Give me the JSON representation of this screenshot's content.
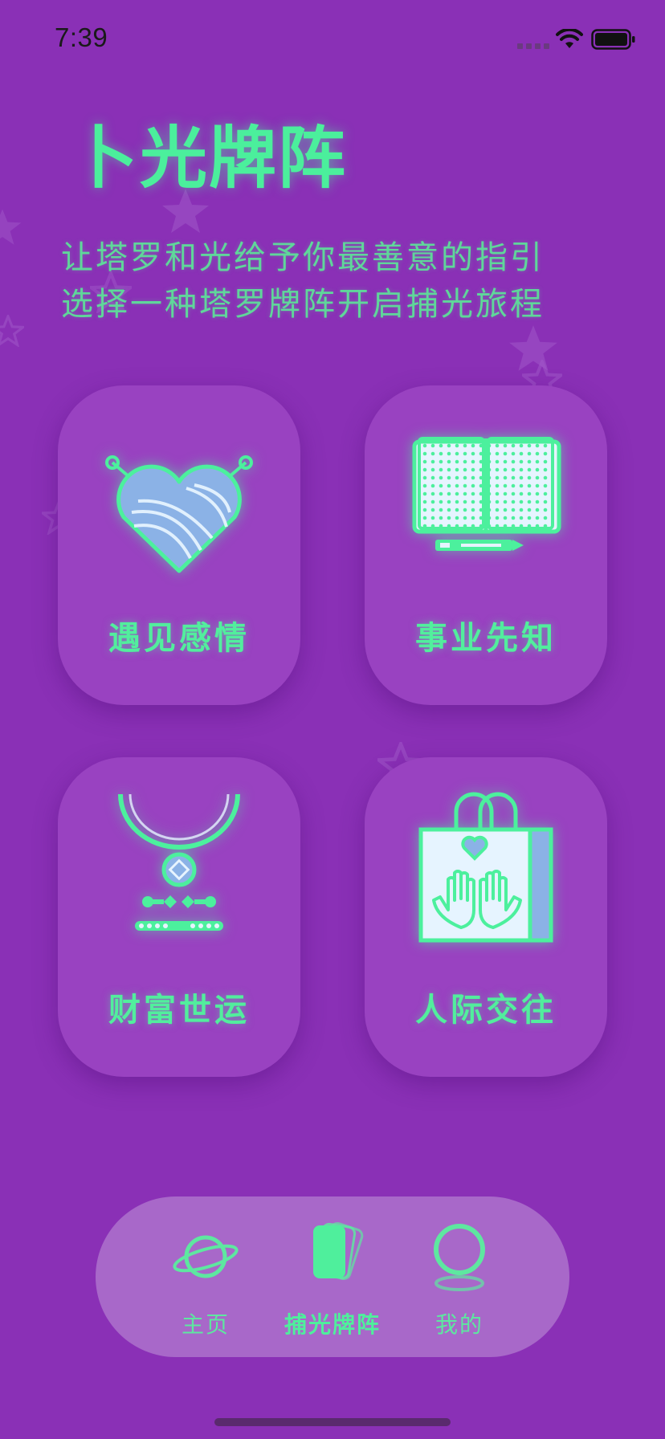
{
  "status_bar": {
    "time": "7:39"
  },
  "header": {
    "title": "卜光牌阵",
    "subtitle_lines": [
      "让塔罗和光给予你最善意的指引",
      "选择一种塔罗牌阵开启捕光旅程"
    ]
  },
  "cards": [
    {
      "label": "遇见感情",
      "icon": "heart-yarn-icon"
    },
    {
      "label": "事业先知",
      "icon": "open-book-icon"
    },
    {
      "label": "财富世运",
      "icon": "necklace-coin-icon"
    },
    {
      "label": "人际交往",
      "icon": "gift-bag-hands-icon"
    }
  ],
  "tab_bar": {
    "items": [
      {
        "label": "主页",
        "icon": "planet-icon",
        "active": false
      },
      {
        "label": "捕光牌阵",
        "icon": "cards-icon",
        "active": true
      },
      {
        "label": "我的",
        "icon": "profile-ring-icon",
        "active": false
      }
    ]
  },
  "colors": {
    "background": "#8a30b6",
    "accent": "#4bef9c",
    "card": "#9942c1",
    "tab_bar": "#a868c9"
  }
}
